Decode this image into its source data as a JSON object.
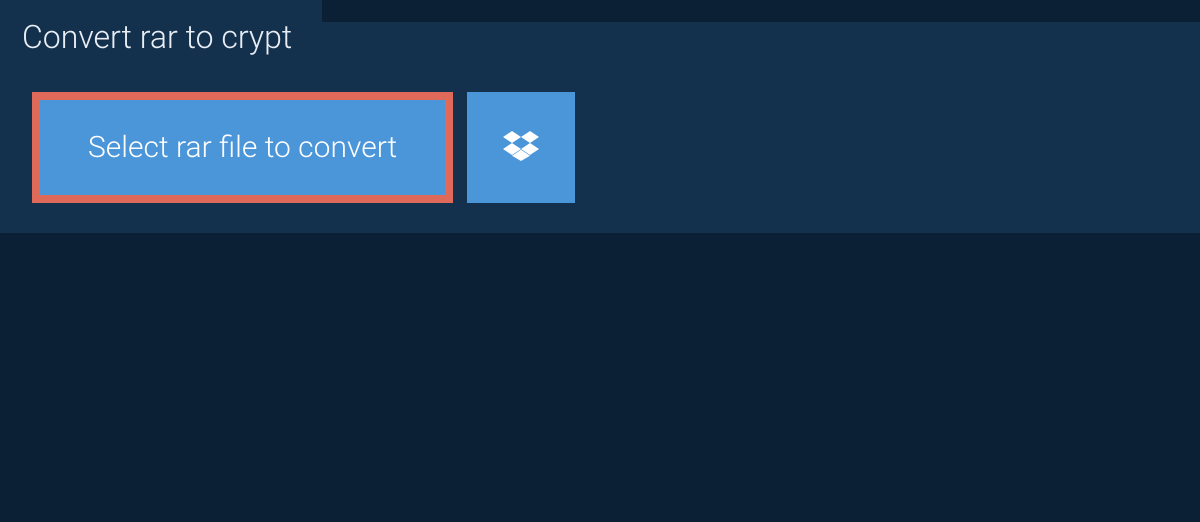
{
  "tab": {
    "title": "Convert rar to crypt"
  },
  "buttons": {
    "select_file_label": "Select rar file to convert"
  },
  "colors": {
    "page_bg": "#0b1f35",
    "panel_bg": "#13304d",
    "button_bg": "#4b95d9",
    "highlight_border": "#e06a5a",
    "text_light": "#e8eef4",
    "text_white": "#ffffff"
  },
  "icons": {
    "dropbox": "dropbox-icon"
  }
}
